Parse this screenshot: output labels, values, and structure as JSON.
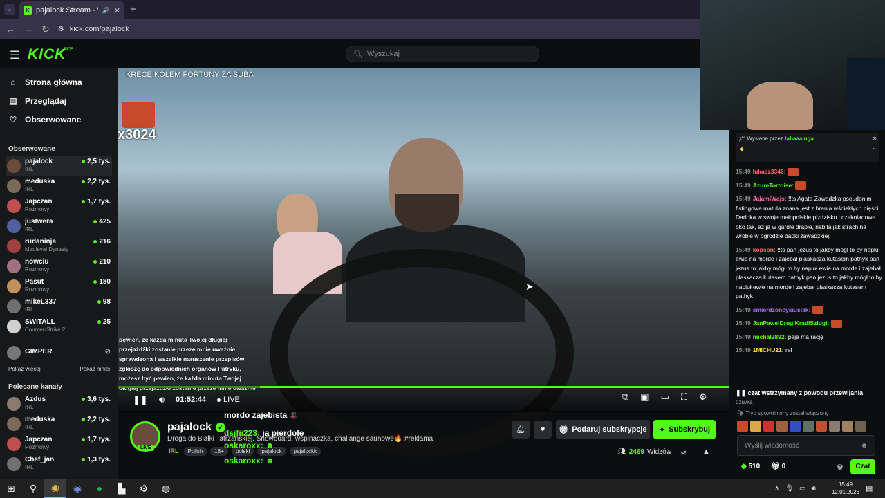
{
  "browser": {
    "tab_title": "pajalock Stream - Watch Li",
    "tab_close": "✕",
    "new_tab": "+",
    "url": "kick.com/pajalock"
  },
  "header": {
    "logo": "KICK",
    "beta": "BETA",
    "search_placeholder": "Wyszukaj"
  },
  "sidebar": {
    "nav": [
      {
        "label": "Strona główna",
        "icon": "home-icon",
        "glyph": "⌂"
      },
      {
        "label": "Przeglądaj",
        "icon": "browse-icon",
        "glyph": "▤"
      },
      {
        "label": "Obserwowane",
        "icon": "heart-icon",
        "glyph": "♡"
      }
    ],
    "followed_heading": "Obserwowane",
    "followed": [
      {
        "name": "pajalock",
        "category": "IRL",
        "viewers": "2,5 tys.",
        "color": "#6b4b3b"
      },
      {
        "name": "meduska",
        "category": "IRL",
        "viewers": "2,2 tys.",
        "color": "#7a6a5a"
      },
      {
        "name": "Japczan",
        "category": "Rozmowy",
        "viewers": "1,7 tys.",
        "color": "#c05050"
      },
      {
        "name": "justwera",
        "category": "IRL",
        "viewers": "425",
        "color": "#5060a0"
      },
      {
        "name": "rudaninja",
        "category": "Medieval Dynasty",
        "viewers": "216",
        "color": "#a04040"
      },
      {
        "name": "nowciu",
        "category": "Rozmowy",
        "viewers": "210",
        "color": "#a07080"
      },
      {
        "name": "Pasut",
        "category": "Rozmowy",
        "viewers": "180",
        "color": "#c09060"
      },
      {
        "name": "mikeL337",
        "category": "IRL",
        "viewers": "98",
        "color": "#707070"
      },
      {
        "name": "SWITALL",
        "category": "Counter-Strike 2",
        "viewers": "25",
        "color": "#d0d0d0"
      }
    ],
    "offline_channel": {
      "name": "GIMPER",
      "status_icon": "⊘"
    },
    "show_more": "Pokaż więcej",
    "show_less": "Pokaż mniej",
    "recommended_heading": "Polecane kanały",
    "recommended": [
      {
        "name": "Azdus",
        "category": "IRL",
        "viewers": "3,6 tys.",
        "color": "#8a7a70"
      },
      {
        "name": "meduska",
        "category": "IRL",
        "viewers": "2,2 tys.",
        "color": "#7a6a5a"
      },
      {
        "name": "Japczan",
        "category": "Rozmowy",
        "viewers": "1,7 tys.",
        "color": "#c05050"
      },
      {
        "name": "Chef_jan",
        "category": "IRL",
        "viewers": "1,3 tys.",
        "color": "#707070"
      }
    ]
  },
  "video": {
    "overlay_title": "KRĘCĘ KOŁEM FORTUNY ZA SUBA",
    "gift_counter": "x3024",
    "subtitle_lines": [
      "pewien, że każda minuta Twojej długiej",
      "przejażdżki zostanie przeze mnie uważnie",
      "sprawdzona i wszelkie naruszenie przepisów",
      "zgłoszę do odpowiednich organów Patryku,",
      "możesz być pewien, że każda minuta Twojej",
      "długiej przejażdżki zostanie przeze mnie uważnie"
    ],
    "time": "01:52:44",
    "live_label": "LIVE",
    "progress": 1.0
  },
  "stream": {
    "name": "pajalock",
    "live_badge": "LIVE",
    "title": "Droga do Białki Tatrzańskiej. Snowboard, wspinaczka, challange saunowe🔥 #reklama",
    "category": "IRL",
    "tags": [
      "Polish",
      "18+",
      "polski",
      "pajalock",
      "pajalockk"
    ],
    "gift_button": "Podaruj subskrypcje",
    "subscribe_button": "Subskrybuj",
    "viewers_count": "2469",
    "viewers_label": "Widzów"
  },
  "overlay_chat": [
    {
      "user": "",
      "text": "mordo zajebista"
    },
    {
      "user": "dsjfii223:",
      "text": "ja pierdole"
    },
    {
      "user": "oskaroxx:",
      "text": ""
    },
    {
      "user": "oskaroxx:",
      "text": ""
    }
  ],
  "chat": {
    "pinned_label": "Wysłane przez",
    "pinned_user": "tabaaaluga",
    "messages": [
      {
        "ts": "15:49",
        "user": "lukasz3346:",
        "color": "#ff6b6b",
        "text": ""
      },
      {
        "ts": "15:49",
        "user": "AzureTortoise:",
        "color": "#53fc18",
        "text": ""
      },
      {
        "ts": "15:49",
        "user": "JajamiWajs:",
        "color": "#ff6b9e",
        "text": "!!ts Agata Zawadzka pseudonim fistingowa matula znana jest z brania wściekłych pięści Darloka w swoje małopolskie pizdzisko i czekoladowe oko tak, aż ją w gardle drapie, nabita jak strach na wróble w ogrodzie bapki zawadzkiej."
      },
      {
        "ts": "15:49",
        "user": "kopson:",
        "color": "#ff6b6b",
        "text": "!!ts pan jezus to jakby mógł to by napluł ewie na morde i zajebał plaskacza kutasem pathyk pan jezus to jakby mógł to by napluł ewie na morde i zajebał plaskacza kutasem pathyk pan jezus to jakby mógł to by napluł ewie na morde i zajebał plaskacza kutasem pathyk"
      },
      {
        "ts": "15:49",
        "user": "smierdzoncysiusiak:",
        "color": "#a070ff",
        "text": ""
      },
      {
        "ts": "15:49",
        "user": "JanPawelDrugiKradlSzlugi:",
        "color": "#53fc18",
        "text": ""
      },
      {
        "ts": "15:49",
        "user": "michal2892:",
        "color": "#53fc18",
        "text": "paja ma rację"
      },
      {
        "ts": "15:49",
        "user": "1MICHU21:",
        "color": "#ffd54a",
        "text": "rel"
      }
    ],
    "paused_notice": "czat wstrzymany z powodu przewijania",
    "paused_trail": "dziwka",
    "slow_mode": "Tryb spowolniony został włączony",
    "input_placeholder": "Wyślij wiadomość",
    "points": "510",
    "gifts": "0",
    "chat_button": "Czat"
  },
  "taskbar": {
    "time": "15:49",
    "date": "12.01.2026"
  }
}
